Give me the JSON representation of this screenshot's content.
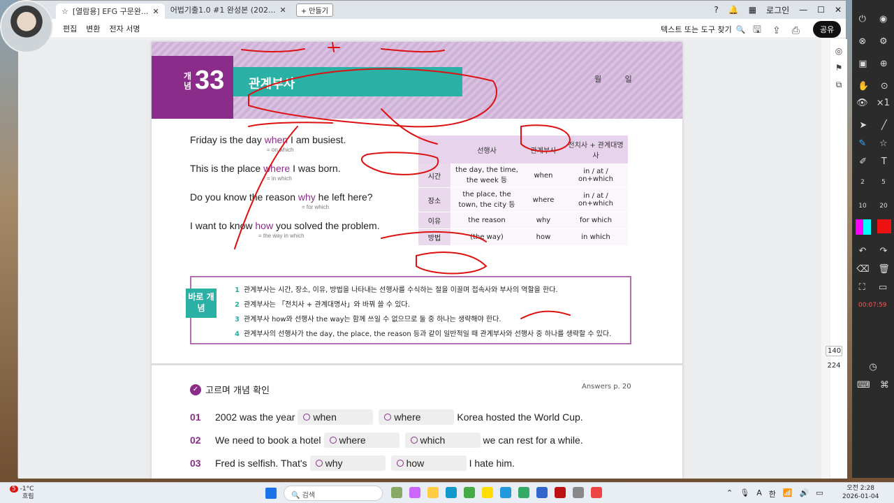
{
  "browser": {
    "tabs": [
      {
        "label": "[열람용] EFG 구문완...",
        "active": true
      },
      {
        "label": "어법기출1.0 #1 완성본 (202...",
        "active": false
      }
    ],
    "new_tab": "+ 만들기",
    "login": "로그인"
  },
  "menubar": {
    "items": [
      "편집",
      "변환",
      "전자 서명"
    ],
    "find": "텍스트 또는 도구 찾기",
    "share": "공유"
  },
  "page": {
    "kanji": "개념",
    "number": "33",
    "topic": "관계부사",
    "monthday": "월 일",
    "examples": [
      {
        "pre": "Friday is ",
        "antecedent": "the day",
        "rel": "when",
        "post": " I am busiest.",
        "sub": "= on which"
      },
      {
        "pre": "This is ",
        "antecedent": "the place",
        "rel": "where",
        "post": " I was born.",
        "sub": "= in which"
      },
      {
        "pre": "Do you know ",
        "antecedent": "the reason",
        "rel": "why",
        "post": " he left here?",
        "sub": "= for which"
      },
      {
        "pre": "I want to know ",
        "antecedent": "",
        "rel": "how",
        "post": " you solved the problem.",
        "sub": "= the way  in which"
      }
    ],
    "table": {
      "headers": [
        "",
        "선행사",
        "관계부사",
        "전치사 + 관계대명사"
      ],
      "rows": [
        [
          "시간",
          "the day, the time, the week 등",
          "when",
          "in / at / on+which"
        ],
        [
          "장소",
          "the place, the town, the city 등",
          "where",
          "in / at / on+which"
        ],
        [
          "이유",
          "the reason",
          "why",
          "for which"
        ],
        [
          "방법",
          "(the way)",
          "how",
          "in which"
        ]
      ]
    },
    "concept": {
      "tag": "바로 개념",
      "items": [
        {
          "n": "1",
          "text": "관계부사는 시간, 장소, 이유, 방법을 나타내는 선행사를 수식하는 절을 이끌며 접속사와 부사의 역할을 한다."
        },
        {
          "n": "2",
          "text": "관계부사는 「전치사 + 관계대명사」와 바꿔 쓸 수 있다."
        },
        {
          "n": "3",
          "text": "관계부사 how와 선행사 the way는 함께 쓰일 수 없으므로 둘 중 하나는 생략해야 한다."
        },
        {
          "n": "4",
          "text": "관계부사의 선행사가 the day, the place, the reason 등과 같이 일반적일 때 관계부사와 선행사 중 하나를 생략할 수 있다."
        }
      ]
    },
    "check": {
      "title": "고르며 개념 확인",
      "answers": "Answers p. 20",
      "questions": [
        {
          "num": "01",
          "pre": "2002 was the year",
          "opt1": "when",
          "opt2": "where",
          "post": "Korea hosted the World Cup."
        },
        {
          "num": "02",
          "pre": "We need to book a hotel",
          "opt1": "where",
          "opt2": "which",
          "post": "we can rest for a while."
        },
        {
          "num": "03",
          "pre": "Fred is selfish. That's",
          "opt1": "why",
          "opt2": "how",
          "post": "I hate him."
        }
      ]
    }
  },
  "pagination": {
    "current": "140",
    "total": "224"
  },
  "recorder": {
    "time": "00:07:59",
    "pen_sizes": [
      "2",
      "5",
      "10",
      "20"
    ],
    "multiplier": "×1"
  },
  "taskbar": {
    "weather_temp": "-1°C",
    "weather_desc": "흐림",
    "search": "검색",
    "time": "오전 2:28",
    "date": "2026-01-04",
    "lang": "한",
    "notif": "5"
  },
  "colors": {
    "accent": "#8b2c8a",
    "teal": "#2ab0a4",
    "ink": "#d11"
  }
}
